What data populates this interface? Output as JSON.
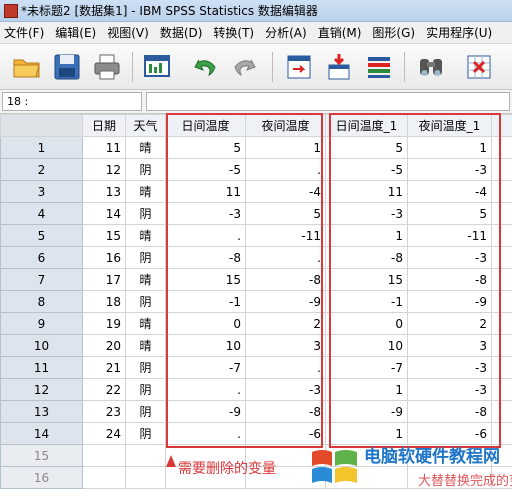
{
  "window": {
    "title": "*未标题2 [数据集1] - IBM SPSS Statistics 数据编辑器"
  },
  "menu": [
    "文件(F)",
    "编辑(E)",
    "视图(V)",
    "数据(D)",
    "转换(T)",
    "分析(A)",
    "直销(M)",
    "图形(G)",
    "实用程序(U)"
  ],
  "toolbar": {
    "icons": [
      "open-folder-icon",
      "save-icon",
      "print-icon",
      "dialog-recall-icon",
      "undo-icon",
      "redo-icon",
      "goto-case-icon",
      "goto-variable-icon",
      "variables-icon",
      "find-icon",
      "insert-cases-icon"
    ]
  },
  "cell_editor": {
    "ref": "18 :",
    "value": ""
  },
  "grid": {
    "columns": [
      "日期",
      "天气",
      "日间温度",
      "夜间温度",
      "日间温度_1",
      "夜间温度_1"
    ],
    "rows": [
      {
        "n": "1",
        "date": "11",
        "weather": "晴",
        "day": "5",
        "night": "1",
        "day1": "5",
        "night1": "1"
      },
      {
        "n": "2",
        "date": "12",
        "weather": "阴",
        "day": "-5",
        "night": ".",
        "day1": "-5",
        "night1": "-3"
      },
      {
        "n": "3",
        "date": "13",
        "weather": "晴",
        "day": "11",
        "night": "-4",
        "day1": "11",
        "night1": "-4"
      },
      {
        "n": "4",
        "date": "14",
        "weather": "阴",
        "day": "-3",
        "night": "5",
        "day1": "-3",
        "night1": "5"
      },
      {
        "n": "5",
        "date": "15",
        "weather": "晴",
        "day": ".",
        "night": "-11",
        "day1": "1",
        "night1": "-11"
      },
      {
        "n": "6",
        "date": "16",
        "weather": "阴",
        "day": "-8",
        "night": ".",
        "day1": "-8",
        "night1": "-3"
      },
      {
        "n": "7",
        "date": "17",
        "weather": "晴",
        "day": "15",
        "night": "-8",
        "day1": "15",
        "night1": "-8"
      },
      {
        "n": "8",
        "date": "18",
        "weather": "阴",
        "day": "-1",
        "night": "-9",
        "day1": "-1",
        "night1": "-9"
      },
      {
        "n": "9",
        "date": "19",
        "weather": "晴",
        "day": "0",
        "night": "2",
        "day1": "0",
        "night1": "2"
      },
      {
        "n": "10",
        "date": "20",
        "weather": "晴",
        "day": "10",
        "night": "3",
        "day1": "10",
        "night1": "3"
      },
      {
        "n": "11",
        "date": "21",
        "weather": "阴",
        "day": "-7",
        "night": ".",
        "day1": "-7",
        "night1": "-3"
      },
      {
        "n": "12",
        "date": "22",
        "weather": "阴",
        "day": ".",
        "night": "-3",
        "day1": "1",
        "night1": "-3"
      },
      {
        "n": "13",
        "date": "23",
        "weather": "阴",
        "day": "-9",
        "night": "-8",
        "day1": "-9",
        "night1": "-8"
      },
      {
        "n": "14",
        "date": "24",
        "weather": "阴",
        "day": ".",
        "night": "-6",
        "day1": "1",
        "night1": "-6"
      },
      {
        "n": "15",
        "date": "",
        "weather": "",
        "day": "",
        "night": "",
        "day1": "",
        "night1": ""
      },
      {
        "n": "16",
        "date": "",
        "weather": "",
        "day": "",
        "night": "",
        "day1": "",
        "night1": ""
      }
    ]
  },
  "annotation": {
    "text": "需要删除的变量",
    "color": "#d9383b"
  },
  "watermark": {
    "line1": "电脑软硬件教程网",
    "line2": "",
    "overlay": "大替替换完成的变量"
  },
  "colors": {
    "accent": "#d9383b",
    "rowhead": "#dde4ee",
    "watermark_blue": "#1f76c9"
  }
}
